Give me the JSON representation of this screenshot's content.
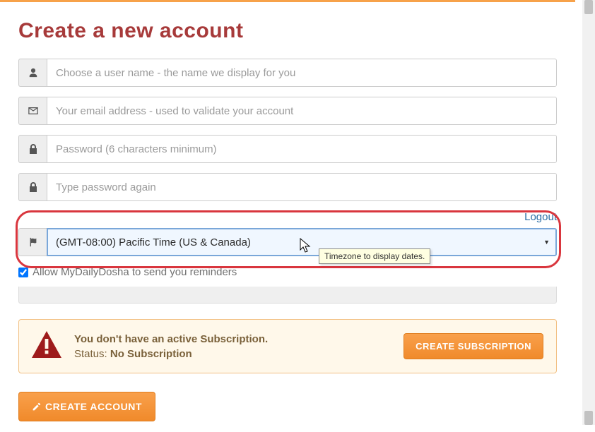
{
  "page": {
    "title": "Create a new account"
  },
  "fields": {
    "username_placeholder": "Choose a user name - the name we display for you",
    "email_placeholder": "Your email address - used to validate your account",
    "password_placeholder": "Password (6 characters minimum)",
    "password2_placeholder": "Type password again"
  },
  "logout": {
    "label": "Logout"
  },
  "timezone": {
    "selected": "(GMT-08:00) Pacific Time (US & Canada)",
    "tooltip": "Timezone to display dates."
  },
  "reminders": {
    "label": "Allow MyDailyDosha to send you reminders",
    "checked": true
  },
  "alert": {
    "line1": "You don't have an active Subscription.",
    "status_label": "Status: ",
    "status_value": "No Subscription",
    "cta": "CREATE SUBSCRIPTION"
  },
  "buttons": {
    "create": "CREATE ACCOUNT"
  },
  "icons": {
    "user": "user",
    "mail": "envelope",
    "lock": "lock",
    "flag": "flag",
    "warning": "warning",
    "pencil": "pencil"
  }
}
